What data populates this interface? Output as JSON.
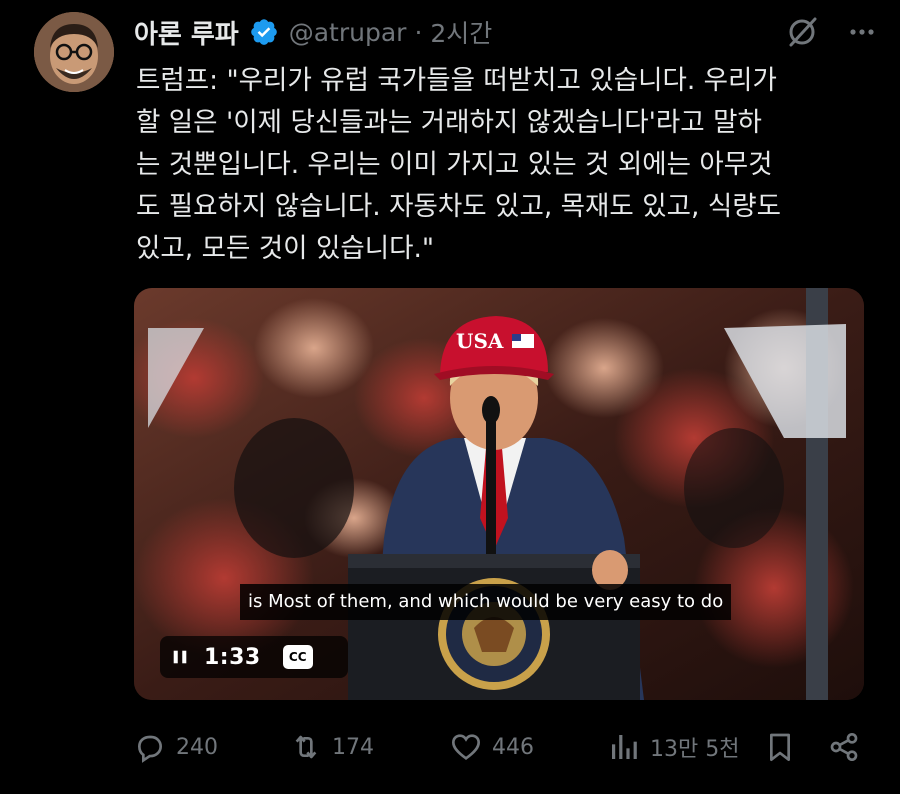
{
  "author": {
    "name": "아론 루파",
    "handle": "@atrupar",
    "separator": "·",
    "time": "2시간",
    "verified_color": "#1d9bf0"
  },
  "tweet": {
    "text": "트럼프: \"우리가 유럽 국가들을 떠받치고 있습니다. 우리가\n할 일은 '이제 당신들과는 거래하지 않겠습니다'라고 말하\n는 것뿐입니다. 우리는 이미 가지고 있는 것 외에는 아무것\n도 필요하지 않습니다. 자동차도 있고, 목재도 있고, 식량도\n있고, 모든 것이 있습니다.\""
  },
  "video": {
    "caption": "is Most of them, and which would be very easy to do",
    "time": "1:33",
    "cc_label": "CC",
    "hat_text": "USA"
  },
  "actions": {
    "replies": "240",
    "retweets": "174",
    "likes": "446",
    "views": "13만 5천"
  },
  "icons": {
    "header": [
      "grok-icon",
      "more-icon"
    ],
    "actions": [
      "reply-icon",
      "retweet-icon",
      "like-icon",
      "views-icon",
      "bookmark-icon",
      "share-icon"
    ]
  },
  "colors": {
    "background": "#000000",
    "text": "#e7e9ea",
    "muted": "#71767b",
    "accent": "#1d9bf0"
  }
}
